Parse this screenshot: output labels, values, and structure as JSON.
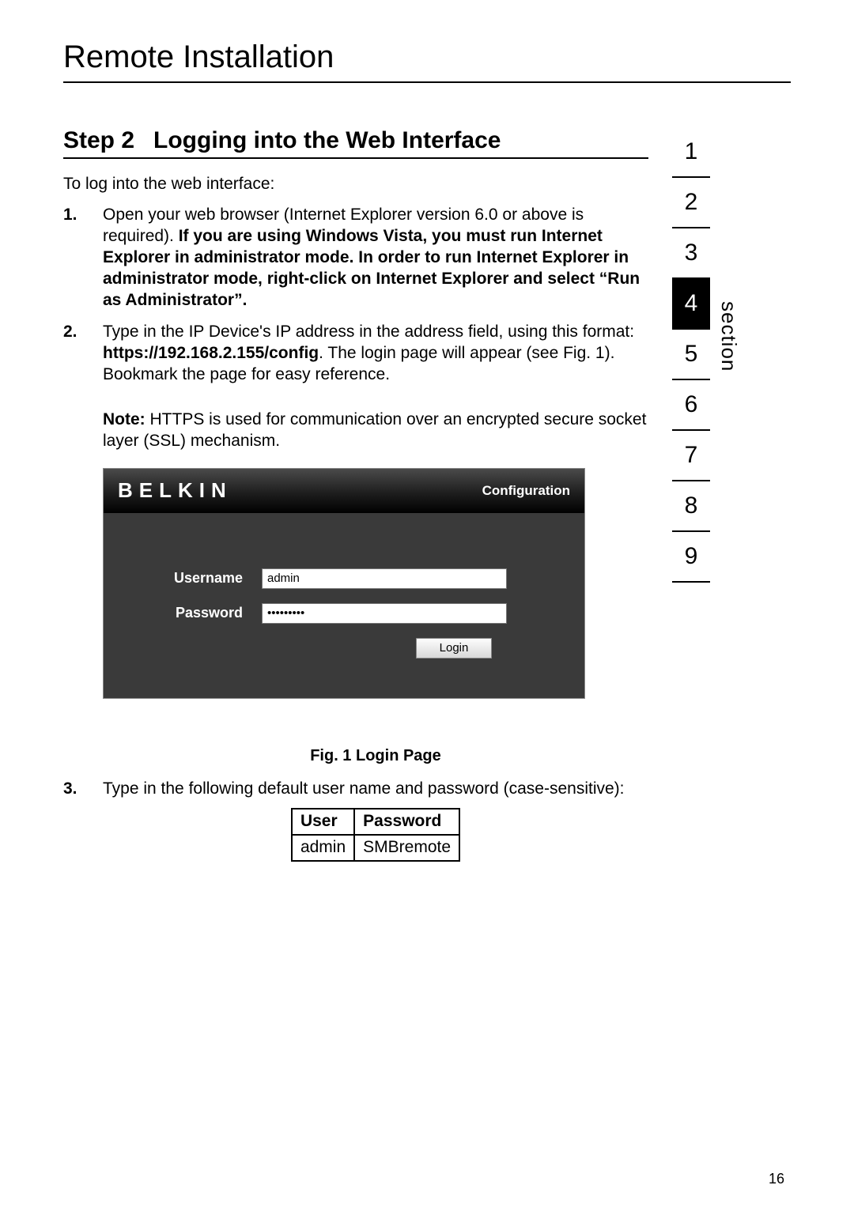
{
  "chapter_title": "Remote Installation",
  "step": {
    "prefix": "Step 2",
    "title": "Logging into the Web Interface"
  },
  "intro": "To log into the web interface:",
  "items": {
    "i1": {
      "num": "1.",
      "text_a": "Open your web browser (Internet Explorer version 6.0 or above is required). ",
      "bold": "If you are using Windows Vista, you must run Internet Explorer in administrator mode. In order to run Internet Explorer in administrator mode, right-click on Internet Explorer and select “Run as Administrator”."
    },
    "i2": {
      "num": "2.",
      "text_a": "Type in the IP Device's IP address in the address field, using this format: ",
      "bold": "https://192.168.2.155/config",
      "text_b": ". The login page will appear (see Fig. 1). Bookmark the page for easy reference.",
      "note_label": "Note:",
      "note_text": " HTTPS is used for communication over an encrypted secure socket layer (SSL) mechanism."
    },
    "i3": {
      "num": "3.",
      "text": "Type in the following default user name and password (case-sensitive):"
    }
  },
  "login_panel": {
    "brand": "BELKIN",
    "config": "Configuration",
    "username_label": "Username",
    "username_value": "admin",
    "password_label": "Password",
    "password_value": "•••••••••",
    "login_button": "Login"
  },
  "fig_caption": "Fig. 1 Login Page",
  "cred_table": {
    "h_user": "User",
    "h_pass": "Password",
    "user": "admin",
    "pass": "SMBremote"
  },
  "nav": {
    "items": [
      "1",
      "2",
      "3",
      "4",
      "5",
      "6",
      "7",
      "8",
      "9"
    ],
    "active_index": 3,
    "label": "section"
  },
  "page_number": "16"
}
